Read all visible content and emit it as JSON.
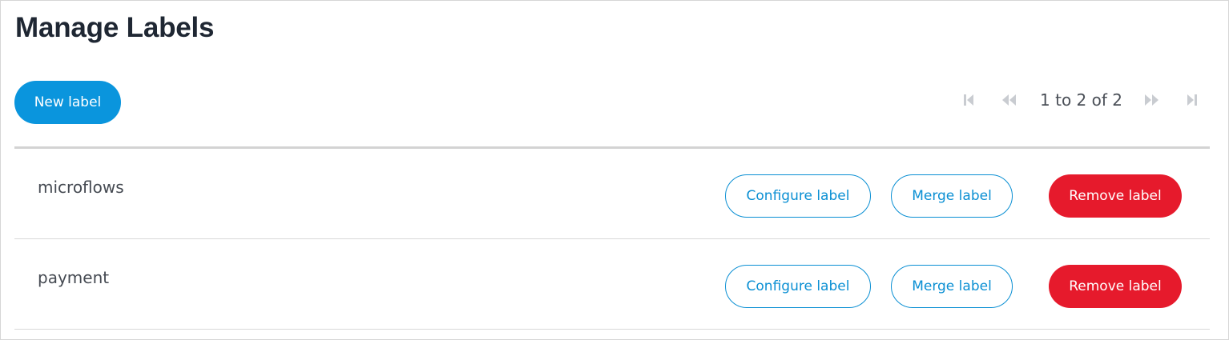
{
  "header": {
    "title": "Manage Labels"
  },
  "toolbar": {
    "new_label": "New label"
  },
  "pagination": {
    "summary": "1 to 2 of 2",
    "icons": [
      "first-page-icon",
      "previous-page-icon",
      "next-page-icon",
      "last-page-icon"
    ],
    "icon_color": "#c9ccd1"
  },
  "labels": [
    {
      "name": "microflows",
      "configure": "Configure label",
      "merge": "Merge label",
      "remove": "Remove label"
    },
    {
      "name": "payment",
      "configure": "Configure label",
      "merge": "Merge label",
      "remove": "Remove label"
    }
  ],
  "colors": {
    "primary": "#0a95dd",
    "outline": "#0a8fd3",
    "danger": "#e61a2c",
    "title": "#1f2733"
  }
}
